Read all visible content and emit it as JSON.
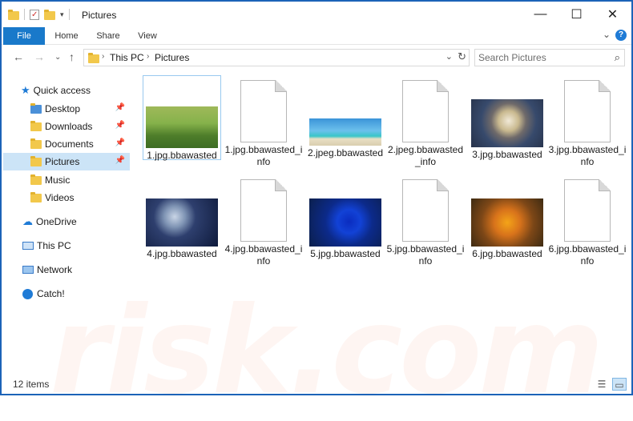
{
  "window": {
    "title": "Pictures",
    "controls": {
      "minimize": "—",
      "maximize": "☐",
      "close": "✕"
    }
  },
  "ribbon": {
    "tabs": [
      "File",
      "Home",
      "Share",
      "View"
    ],
    "help": "?"
  },
  "address": {
    "crumbs": [
      "This PC",
      "Pictures"
    ],
    "search_placeholder": "Search Pictures"
  },
  "nav": {
    "quick_access": "Quick access",
    "items": [
      {
        "label": "Desktop",
        "pinned": true
      },
      {
        "label": "Downloads",
        "pinned": true
      },
      {
        "label": "Documents",
        "pinned": true
      },
      {
        "label": "Pictures",
        "pinned": true
      },
      {
        "label": "Music",
        "pinned": false
      },
      {
        "label": "Videos",
        "pinned": false
      }
    ],
    "onedrive": "OneDrive",
    "this_pc": "This PC",
    "network": "Network",
    "catch": "Catch!"
  },
  "files": [
    {
      "name": "1.jpg.bbawasted",
      "type": "image"
    },
    {
      "name": "1.jpg.bbawasted_info",
      "type": "doc"
    },
    {
      "name": "2.jpeg.bbawasted",
      "type": "image"
    },
    {
      "name": "2.jpeg.bbawasted_info",
      "type": "doc"
    },
    {
      "name": "3.jpg.bbawasted",
      "type": "image"
    },
    {
      "name": "3.jpg.bbawasted_info",
      "type": "doc"
    },
    {
      "name": "4.jpg.bbawasted",
      "type": "image"
    },
    {
      "name": "4.jpg.bbawasted_info",
      "type": "doc"
    },
    {
      "name": "5.jpg.bbawasted",
      "type": "image"
    },
    {
      "name": "5.jpg.bbawasted_info",
      "type": "doc"
    },
    {
      "name": "6.jpg.bbawasted",
      "type": "image"
    },
    {
      "name": "6.jpg.bbawasted_info",
      "type": "doc"
    }
  ],
  "status": {
    "count": "12 items"
  },
  "colors": {
    "accent": "#1979ca",
    "selection": "#cce4f7",
    "border": "#1c63b8"
  }
}
